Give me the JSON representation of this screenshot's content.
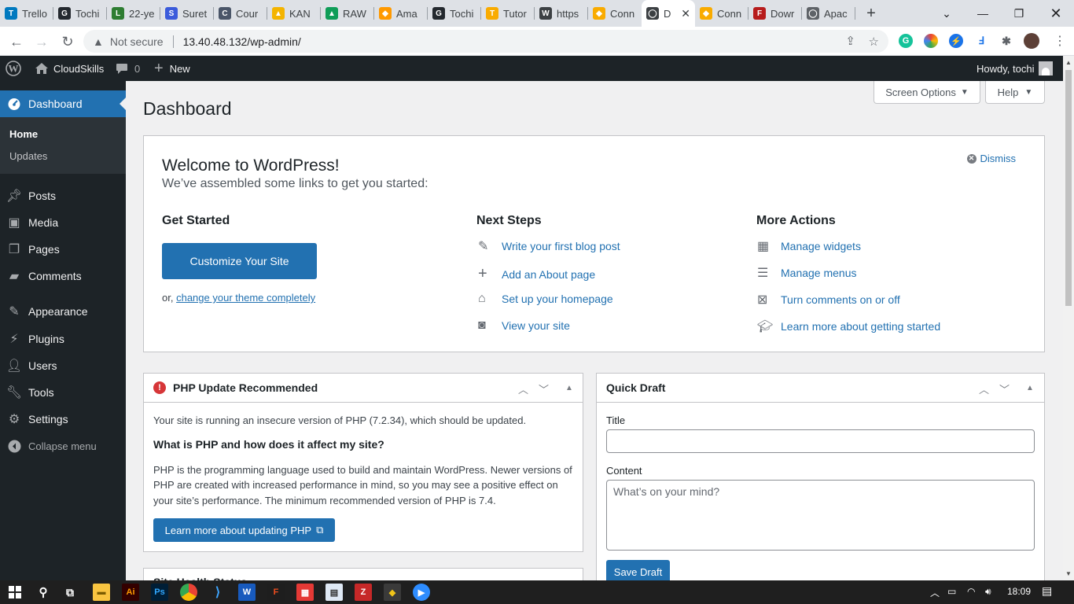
{
  "browser": {
    "tabs": [
      {
        "title": "Trello",
        "color": "#0079bf",
        "glyph": "T"
      },
      {
        "title": "Tochi",
        "color": "#24292f",
        "glyph": "G"
      },
      {
        "title": "22-ye",
        "color": "#2e7d32",
        "glyph": "L"
      },
      {
        "title": "Suret",
        "color": "#3b5bdb",
        "glyph": "S"
      },
      {
        "title": "Cour",
        "color": "#4a5568",
        "glyph": "C"
      },
      {
        "title": "KAN",
        "color": "#f4b400",
        "glyph": "▲"
      },
      {
        "title": "RAW",
        "color": "#0f9d58",
        "glyph": "▲"
      },
      {
        "title": "Ama",
        "color": "#ff9900",
        "glyph": "◆"
      },
      {
        "title": "Tochi",
        "color": "#24292f",
        "glyph": "G"
      },
      {
        "title": "Tutor",
        "color": "#f9ab00",
        "glyph": "T"
      },
      {
        "title": "https",
        "color": "#3c4043",
        "glyph": "W"
      },
      {
        "title": "Conn",
        "color": "#f9ab00",
        "glyph": "◆"
      },
      {
        "title": "D",
        "color": "#3c4043",
        "glyph": "◯",
        "active": true
      },
      {
        "title": "Conn",
        "color": "#f9ab00",
        "glyph": "◆"
      },
      {
        "title": "Dowr",
        "color": "#b71c1c",
        "glyph": "F"
      },
      {
        "title": "Apac",
        "color": "#5f6368",
        "glyph": "◯"
      }
    ],
    "security_label": "Not secure",
    "url": "13.40.48.132/wp-admin/"
  },
  "adminbar": {
    "site_name": "CloudSkills",
    "comments_count": "0",
    "new_label": "New",
    "howdy": "Howdy, tochi"
  },
  "sidebar": {
    "dashboard": "Dashboard",
    "home": "Home",
    "updates": "Updates",
    "items": [
      "Posts",
      "Media",
      "Pages",
      "Comments",
      "Appearance",
      "Plugins",
      "Users",
      "Tools",
      "Settings"
    ],
    "collapse": "Collapse menu"
  },
  "page": {
    "title": "Dashboard",
    "screen_options": "Screen Options",
    "help": "Help"
  },
  "welcome": {
    "title": "Welcome to WordPress!",
    "about": "We’ve assembled some links to get you started:",
    "dismiss": "Dismiss",
    "get_started": "Get Started",
    "customize_button": "Customize Your Site",
    "or_text": "or,",
    "change_theme": "change your theme completely",
    "next_steps": "Next Steps",
    "next_links": [
      "Write your first blog post",
      "Add an About page",
      "Set up your homepage",
      "View your site"
    ],
    "more_actions": "More Actions",
    "more_links": [
      "Manage widgets",
      "Manage menus",
      "Turn comments on or off",
      "Learn more about getting started"
    ]
  },
  "php_box": {
    "title": "PHP Update Recommended",
    "text1": "Your site is running an insecure version of PHP (7.2.34), which should be updated.",
    "heading": "What is PHP and how does it affect my site?",
    "text2_line1": "PHP is the programming language used to build and maintain WordPress. Newer versions of",
    "text2_line2": "PHP are created with increased performance in mind, so you may see a positive effect on",
    "text2_line3": "your site’s performance. The minimum recommended version of PHP is 7.4.",
    "button": "Learn more about updating PHP"
  },
  "site_health": {
    "title": "Site Health Status"
  },
  "quick_draft": {
    "title": "Quick Draft",
    "title_label": "Title",
    "title_value": "",
    "content_label": "Content",
    "content_placeholder": "What’s on your mind?",
    "save": "Save Draft"
  },
  "taskbar": {
    "time": "18:09"
  }
}
